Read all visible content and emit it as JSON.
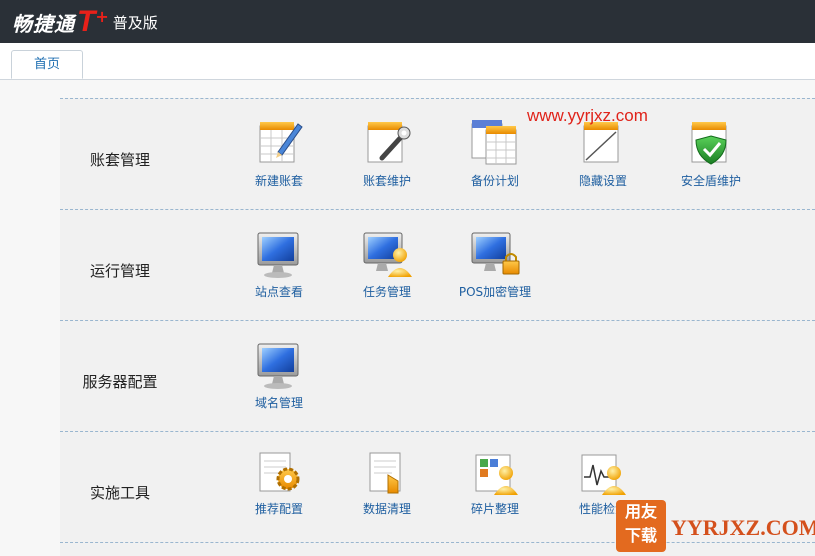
{
  "header": {
    "logo_cn": "畅捷通",
    "logo_t": "T",
    "logo_plus": "+",
    "edition": "普及版"
  },
  "tabs": [
    {
      "label": "首页"
    }
  ],
  "sections": [
    {
      "title": "账套管理",
      "items": [
        {
          "label": "新建账套",
          "icon": "calendar-pencil-icon"
        },
        {
          "label": "账套维护",
          "icon": "calendar-wrench-icon"
        },
        {
          "label": "备份计划",
          "icon": "calendars-icon"
        },
        {
          "label": "隐藏设置",
          "icon": "hidden-calendar-icon"
        },
        {
          "label": "安全盾维护",
          "icon": "shield-check-icon"
        }
      ]
    },
    {
      "title": "运行管理",
      "items": [
        {
          "label": "站点查看",
          "icon": "monitor-icon"
        },
        {
          "label": "任务管理",
          "icon": "monitor-user-icon"
        },
        {
          "label": "POS加密管理",
          "icon": "monitor-lock-icon"
        }
      ]
    },
    {
      "title": "服务器配置",
      "items": [
        {
          "label": "域名管理",
          "icon": "monitor-icon"
        }
      ]
    },
    {
      "title": "实施工具",
      "items": [
        {
          "label": "推荐配置",
          "icon": "document-gear-icon"
        },
        {
          "label": "数据清理",
          "icon": "document-recycle-icon"
        },
        {
          "label": "碎片整理",
          "icon": "fragments-user-icon"
        },
        {
          "label": "性能检测",
          "icon": "pulse-user-icon"
        }
      ]
    }
  ],
  "watermark": {
    "url": "www.yyrjxz.com",
    "badge_line1": "用友",
    "badge_line2": "下载",
    "site": "YYRJXZ.COM"
  },
  "colors": {
    "topbar": "#2a3037",
    "accent": "#e8211a",
    "link": "#1f5fa0"
  }
}
